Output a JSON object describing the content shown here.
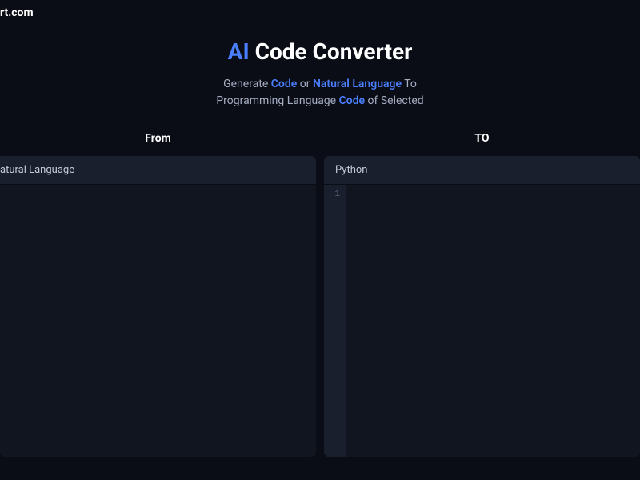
{
  "logo": "rt.com",
  "title": {
    "accent": "AI",
    "rest": "Code Converter"
  },
  "subtitle": {
    "line1_pre": "Generate ",
    "line1_a1": "Code",
    "line1_mid": " or ",
    "line1_a2": "Natural Language",
    "line1_post": " To",
    "line2_pre": "Programming Language ",
    "line2_a1": "Code",
    "line2_post": " of Selected"
  },
  "from": {
    "label": "From",
    "selected": "atural Language"
  },
  "to": {
    "label": "TO",
    "selected": "Python",
    "line_number": "1"
  }
}
